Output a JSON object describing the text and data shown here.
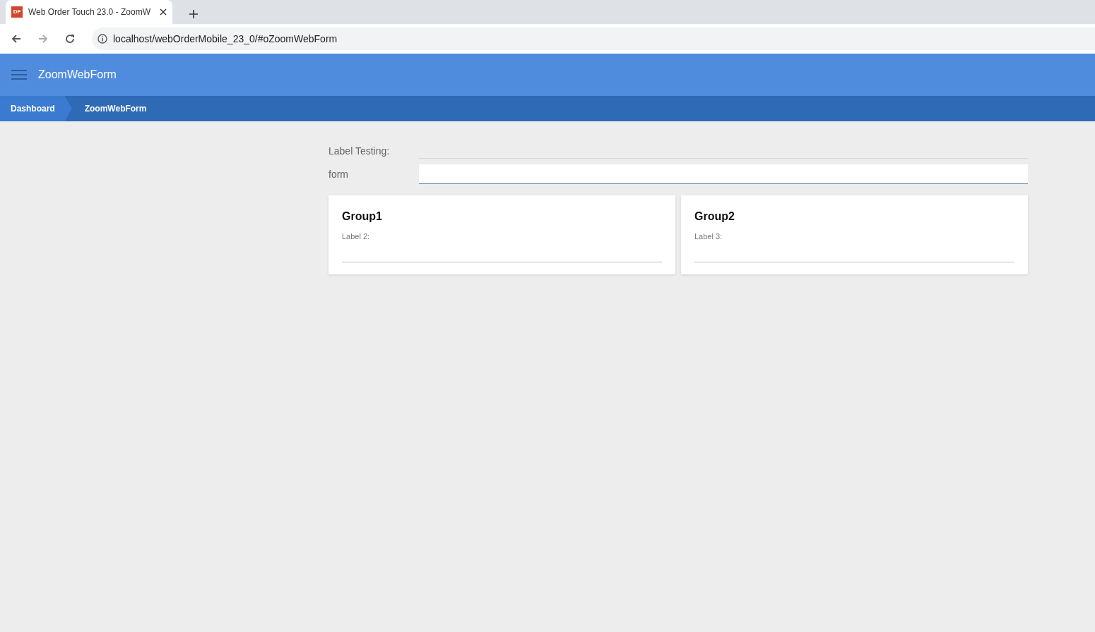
{
  "browser": {
    "tab_title": "Web Order Touch 23.0 - ZoomW",
    "favicon_text": "DF",
    "url": "localhost/webOrderMobile_23_0/#oZoomWebForm"
  },
  "header": {
    "title": "ZoomWebForm"
  },
  "breadcrumbs": [
    {
      "label": "Dashboard",
      "selected": false
    },
    {
      "label": "ZoomWebForm",
      "selected": true
    }
  ],
  "form": {
    "label_testing": "Label Testing:",
    "field_label": "form"
  },
  "groups": [
    {
      "title": "Group1",
      "field_label": "Label 2:"
    },
    {
      "title": "Group2",
      "field_label": "Label 3:"
    }
  ]
}
